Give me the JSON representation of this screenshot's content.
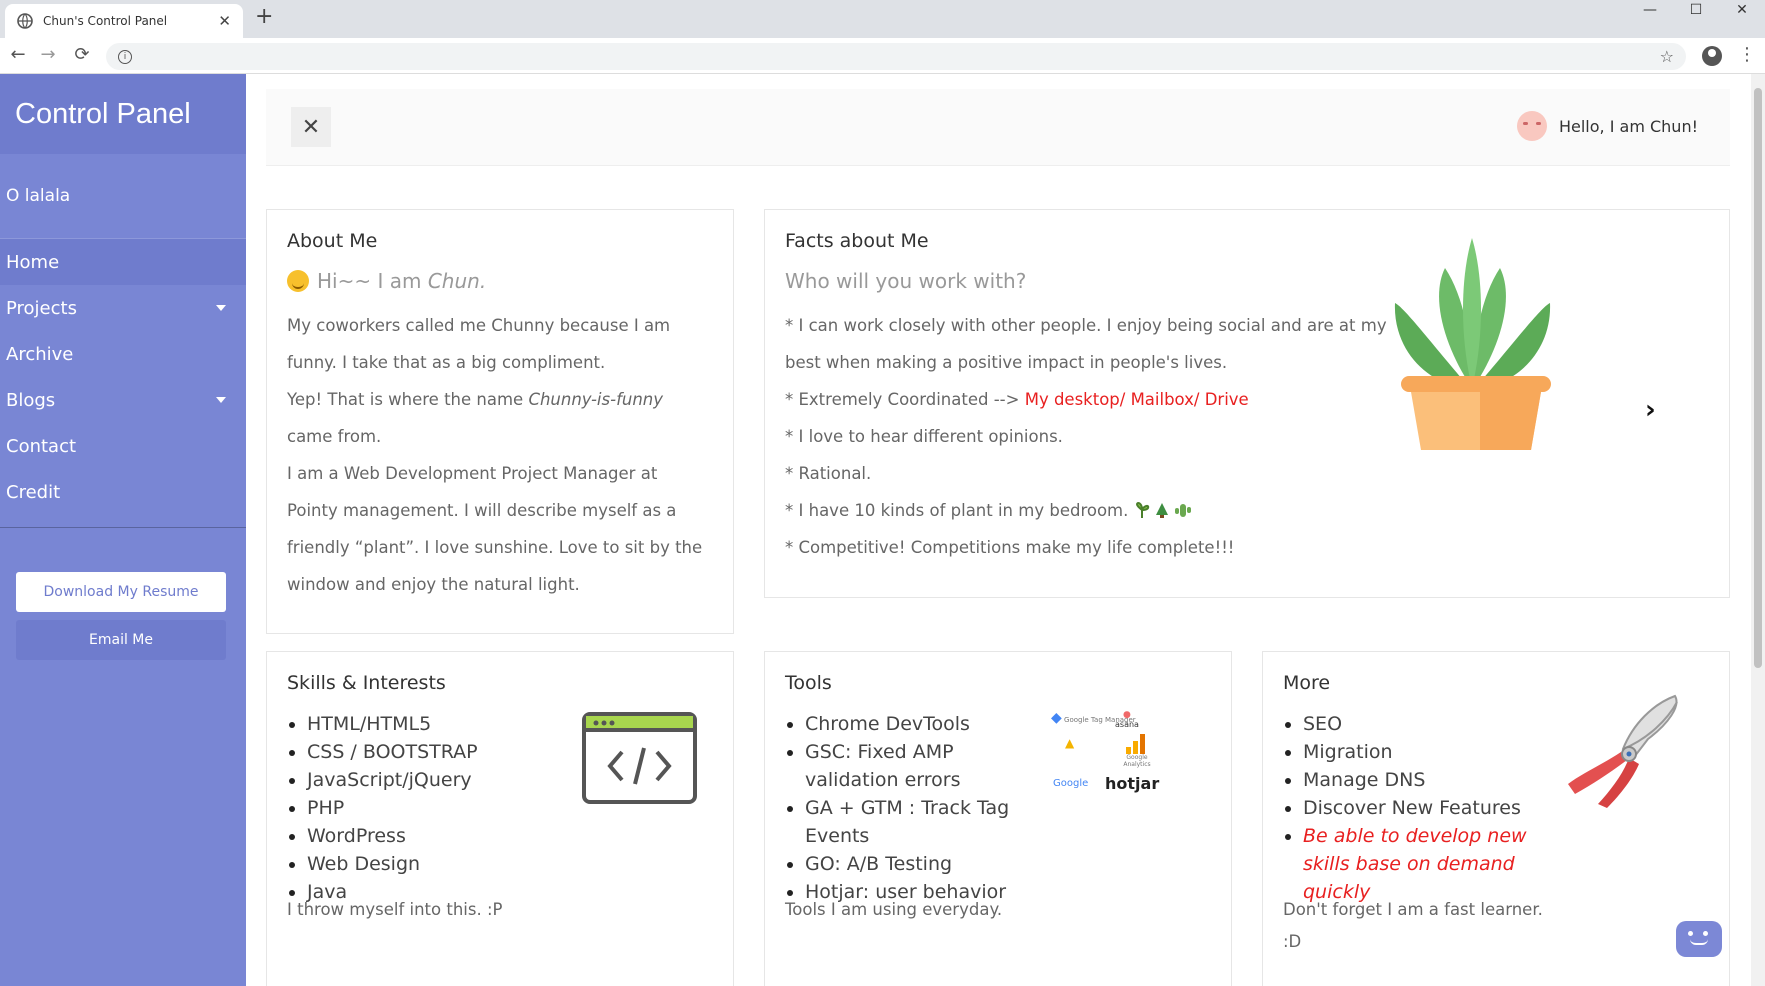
{
  "browser": {
    "tab_title": "Chun's Control Panel",
    "tab_close": "✕",
    "new_tab": "+",
    "back": "←",
    "forward": "→",
    "reload": "⟳",
    "star": "☆",
    "minimize": "—",
    "maximize": "☐",
    "close": "✕",
    "menu": "⋮"
  },
  "sidebar": {
    "brand": "Control Panel",
    "user": "O lalala",
    "items": [
      {
        "label": "Home",
        "active": true
      },
      {
        "label": "Projects",
        "dropdown": true
      },
      {
        "label": "Archive"
      },
      {
        "label": "Blogs",
        "dropdown": true
      },
      {
        "label": "Contact"
      },
      {
        "label": "Credit"
      }
    ],
    "download_resume": "Download My Resume",
    "email_me": "Email Me"
  },
  "topbar": {
    "close_icon": "✕",
    "greeting": "Hello, I am Chun!"
  },
  "about": {
    "title": "About Me",
    "subtitle_pre": "Hi~~ I am ",
    "subtitle_name": "Chun.",
    "lines": [
      "My coworkers called me Chunny because I am",
      "funny. I take that as a big compliment.",
      "came from.",
      "I am a Web Development Project Manager at",
      "Pointy management. I will describe myself as a",
      "friendly “plant”. I love sunshine. Love to sit by the",
      "window and enjoy the natural light."
    ],
    "yep_pre": "Yep! That is where the name ",
    "yep_em": "Chunny-is-funny"
  },
  "facts": {
    "title": "Facts about Me",
    "subtitle": "Who will you work with?",
    "line1a": "* I can work closely with other people. I enjoy being social and are at my",
    "line1b": "best when making a positive impact in people's lives.",
    "line2_pre": "* Extremely Coordinated -->",
    "line2_link": "My desktop/ Mailbox/ Drive",
    "line3": "* I love to hear different opinions.",
    "line4": "* Rational.",
    "line5": "* I have 10 kinds of plant in my bedroom.",
    "line6": "* Competitive! Competitions make my life complete!!!",
    "next_icon": "›"
  },
  "skills": {
    "title": "Skills & Interests",
    "items": [
      "HTML/HTML5",
      "CSS / BOOTSTRAP",
      "JavaScript/jQuery",
      "PHP",
      "WordPress",
      "Web Design",
      "Java"
    ],
    "footer": "I throw myself into this. :P"
  },
  "tools": {
    "title": "Tools",
    "items": [
      "Chrome DevTools",
      "GSC: Fixed AMP validation errors",
      "GA + GTM : Track Tag Events",
      "GO: A/B Testing",
      "Hotjar: user behavior"
    ],
    "footer": "Tools I am using everyday.",
    "logos": {
      "gtm": "Google Tag Manager",
      "asana": "asana",
      "ga": "Google Analytics",
      "google": "Google",
      "hotjar": "hotjar"
    }
  },
  "more": {
    "title": "More",
    "items": [
      "SEO",
      "Migration",
      "Manage DNS",
      "Discover New Features"
    ],
    "highlight": "Be able to develop new skills base on demand quickly",
    "footer1": "Don't forget I am a fast learner.",
    "footer2": ":D"
  },
  "colors": {
    "sidebar": "#7986d4",
    "accent_red": "#e82020"
  }
}
